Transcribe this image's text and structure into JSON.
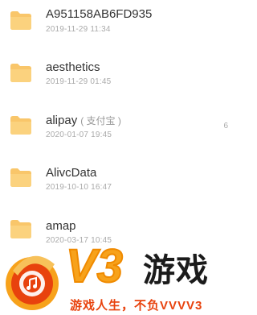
{
  "files": [
    {
      "name": "A951158AB6FD935",
      "note": "",
      "date": "2019-11-29 11:34",
      "trail": ""
    },
    {
      "name": "aesthetics",
      "note": "",
      "date": "2019-11-29 01:45",
      "trail": ""
    },
    {
      "name": "alipay",
      "note": "( 支付宝 )",
      "date": "2020-01-07 19:45",
      "trail": "6"
    },
    {
      "name": "AlivcData",
      "note": "",
      "date": "2019-10-10 16:47",
      "trail": ""
    },
    {
      "name": "amap",
      "note": "",
      "date": "2020-03-17 10:45",
      "trail": ""
    }
  ],
  "folder_color": "#f9c66a",
  "watermark": {
    "brand": "V3",
    "title": "游戏",
    "slogan": "游戏人生，不负VVVV3",
    "colors": {
      "orange": "#f7a21b",
      "red": "#e8420d"
    }
  }
}
